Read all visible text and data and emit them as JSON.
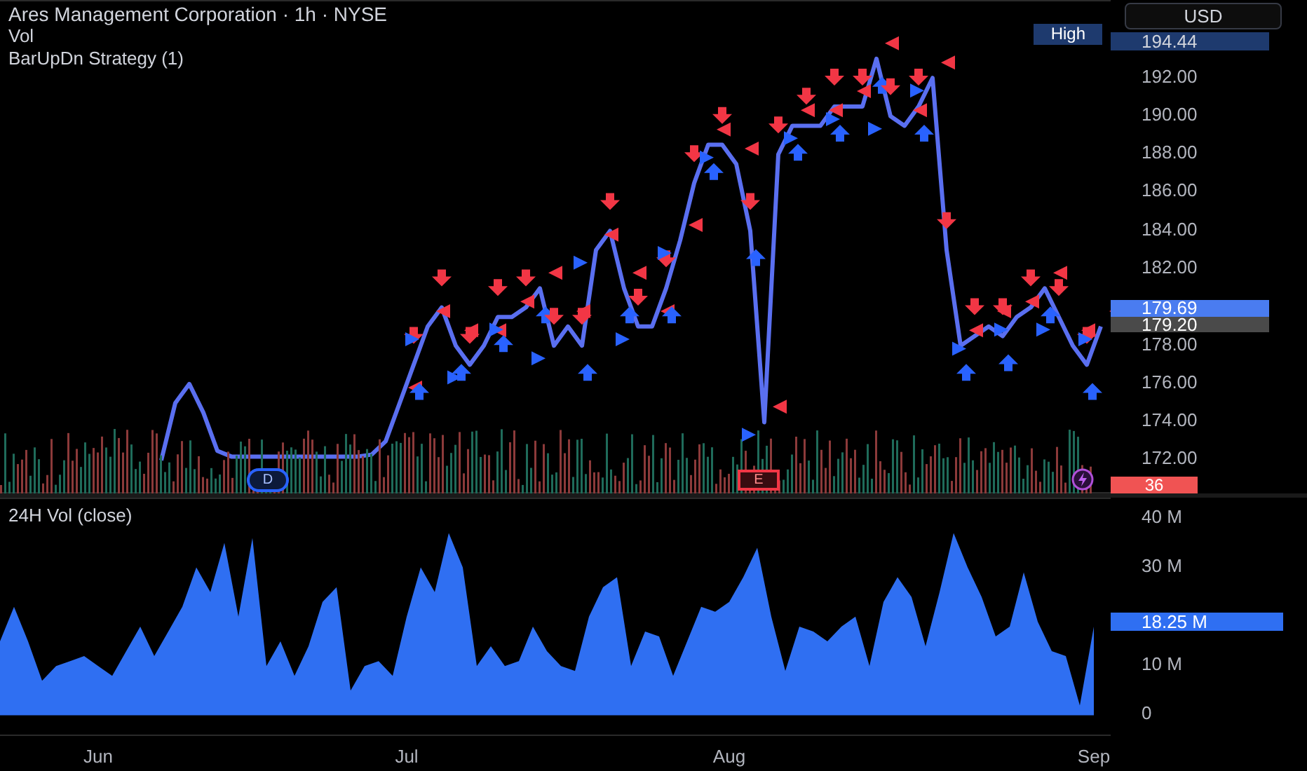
{
  "header": {
    "title": "Ares Management Corporation · 1h · NYSE",
    "indicators": [
      "Vol",
      "BarUpDn Strategy (1)"
    ]
  },
  "currency_button": "USD",
  "price_pane": {
    "chart_data": {
      "type": "line",
      "ylim": [
        170.2,
        196
      ],
      "yticks": [
        {
          "value": 172,
          "label": "172.00"
        },
        {
          "value": 174,
          "label": "174.00"
        },
        {
          "value": 176,
          "label": "176.00"
        },
        {
          "value": 178,
          "label": "178.00"
        },
        {
          "value": 182,
          "label": "182.00"
        },
        {
          "value": 184,
          "label": "184.00"
        },
        {
          "value": 186,
          "label": "186.00"
        },
        {
          "value": 188,
          "label": "188.00"
        },
        {
          "value": 190,
          "label": "190.00"
        },
        {
          "value": 192,
          "label": "192.00"
        }
      ],
      "categories": [
        null,
        null,
        null,
        null,
        null,
        null,
        null,
        null,
        null,
        null,
        null,
        null,
        null,
        null,
        null,
        null,
        null,
        null,
        null,
        null,
        null,
        null,
        null,
        null,
        null,
        null,
        null,
        null,
        null,
        null,
        null,
        null,
        null,
        null,
        null,
        null,
        null,
        null,
        null,
        null,
        null,
        null,
        null,
        null,
        null,
        null,
        null,
        null,
        null,
        null,
        null,
        null,
        null,
        null,
        null,
        null,
        null,
        null,
        null,
        null,
        null,
        null,
        null,
        null,
        null,
        null,
        null,
        null
      ],
      "series": [
        {
          "color": "#5a6ff0",
          "values": [
            172,
            175,
            176,
            174.5,
            172.5,
            172.2,
            172.2,
            172.2,
            172.2,
            172.2,
            172.2,
            172.2,
            172.2,
            172.2,
            172.2,
            172.3,
            173,
            175,
            177,
            179,
            180,
            178,
            177,
            178,
            179.5,
            179.5,
            180,
            181,
            178,
            179,
            178,
            183,
            184,
            181,
            179,
            179,
            181,
            183.5,
            186.5,
            188.5,
            188.5,
            187.5,
            184,
            174,
            188,
            189.5,
            189.5,
            189.5,
            190.5,
            190.5,
            190.5,
            193,
            190,
            189.5,
            190.5,
            192,
            183,
            178,
            178.5,
            179,
            178.5,
            179.5,
            180,
            181,
            179.5,
            178,
            177,
            179
          ]
        }
      ]
    },
    "high_label": "High",
    "high_value": "194.44",
    "last_price": "179.69",
    "prev_close": "179.20",
    "countdown": "36",
    "events": [
      {
        "kind": "dividend",
        "label": "D"
      },
      {
        "kind": "earnings",
        "label": "E"
      },
      {
        "kind": "split"
      }
    ]
  },
  "volume_pane": {
    "title": "24H Vol (close)",
    "value_label": "18.25 M",
    "chart_data": {
      "type": "area",
      "ylim": [
        -4.5,
        43.9
      ],
      "yticks": [
        {
          "value": 0,
          "label": "0"
        },
        {
          "value": 10,
          "label": "10 M"
        },
        {
          "value": 30,
          "label": "30 M"
        },
        {
          "value": 40,
          "label": "40 M"
        }
      ],
      "categories": [
        null,
        null,
        null,
        null,
        null,
        null,
        null,
        "Jun",
        null,
        null,
        null,
        null,
        null,
        null,
        null,
        null,
        null,
        null,
        null,
        null,
        null,
        null,
        null,
        null,
        null,
        null,
        null,
        null,
        null,
        "Jul",
        null,
        null,
        null,
        null,
        null,
        null,
        null,
        null,
        null,
        null,
        null,
        null,
        null,
        null,
        null,
        null,
        null,
        null,
        null,
        null,
        null,
        null,
        "Aug",
        null,
        null,
        null,
        null,
        null,
        null,
        null,
        null,
        null,
        null,
        null,
        null,
        null,
        null,
        null,
        null,
        null,
        null,
        null,
        null,
        null,
        null,
        null,
        null,
        null,
        "Sep"
      ],
      "series": [
        {
          "color": "#2f6ff2",
          "values": [
            15,
            22,
            15,
            7,
            10,
            11,
            12,
            10,
            8,
            13,
            18,
            12,
            17,
            22,
            30,
            25,
            35,
            20,
            36,
            10,
            15,
            8,
            14,
            23,
            26,
            5,
            10,
            11,
            8,
            20,
            30,
            25,
            37,
            30,
            10,
            14,
            10,
            11,
            18,
            13,
            10,
            9,
            20,
            26,
            28,
            10,
            17,
            16,
            8,
            15,
            22,
            21,
            23,
            28,
            34,
            20,
            9,
            18,
            17,
            15,
            18,
            20,
            10,
            23,
            28,
            24,
            14,
            25,
            37,
            30,
            24,
            16,
            18,
            29,
            19,
            13,
            12,
            2,
            18
          ]
        }
      ]
    }
  }
}
